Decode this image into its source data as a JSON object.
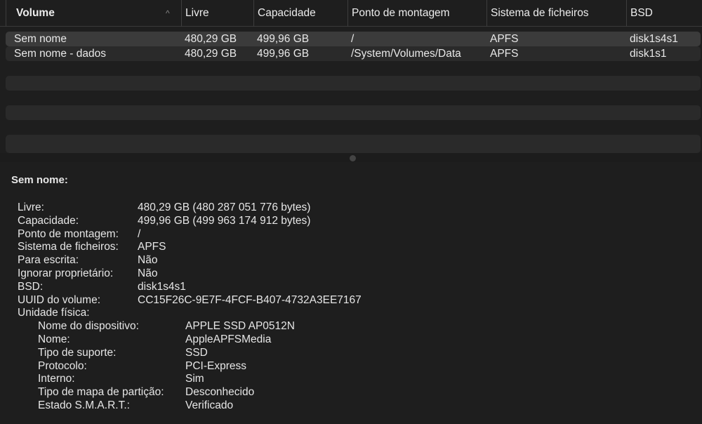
{
  "columns": [
    "Volume",
    "Livre",
    "Capacidade",
    "Ponto de montagem",
    "Sistema de ficheiros",
    "BSD"
  ],
  "rows": [
    [
      "Sem nome",
      "480,29 GB",
      "499,96 GB",
      "/",
      "APFS",
      "disk1s4s1"
    ],
    [
      "Sem nome - dados",
      "480,29 GB",
      "499,96 GB",
      "/System/Volumes/Data",
      "APFS",
      "disk1s1"
    ]
  ],
  "sort_indicator": "^",
  "detail": {
    "title": "Sem nome:",
    "fields": [
      [
        "Livre:",
        "480,29 GB (480 287 051 776 bytes)"
      ],
      [
        "Capacidade:",
        "499,96 GB (499 963 174 912 bytes)"
      ],
      [
        "Ponto de montagem:",
        "/"
      ],
      [
        "Sistema de ficheiros:",
        "APFS"
      ],
      [
        "Para escrita:",
        "Não"
      ],
      [
        "Ignorar proprietário:",
        "Não"
      ],
      [
        "BSD:",
        "disk1s4s1"
      ],
      [
        "UUID do volume:",
        "CC15F26C-9E7F-4FCF-B407-4732A3EE7167"
      ],
      [
        "Unidade física:",
        ""
      ]
    ],
    "physical": [
      [
        "Nome do dispositivo:",
        "APPLE SSD AP0512N"
      ],
      [
        "Nome:",
        "AppleAPFSMedia"
      ],
      [
        "Tipo de suporte:",
        "SSD"
      ],
      [
        "Protocolo:",
        "PCI-Express"
      ],
      [
        "Interno:",
        "Sim"
      ],
      [
        "Tipo de mapa de partição:",
        "Desconhecido"
      ],
      [
        "Estado S.M.A.R.T.:",
        "Verificado"
      ]
    ]
  }
}
